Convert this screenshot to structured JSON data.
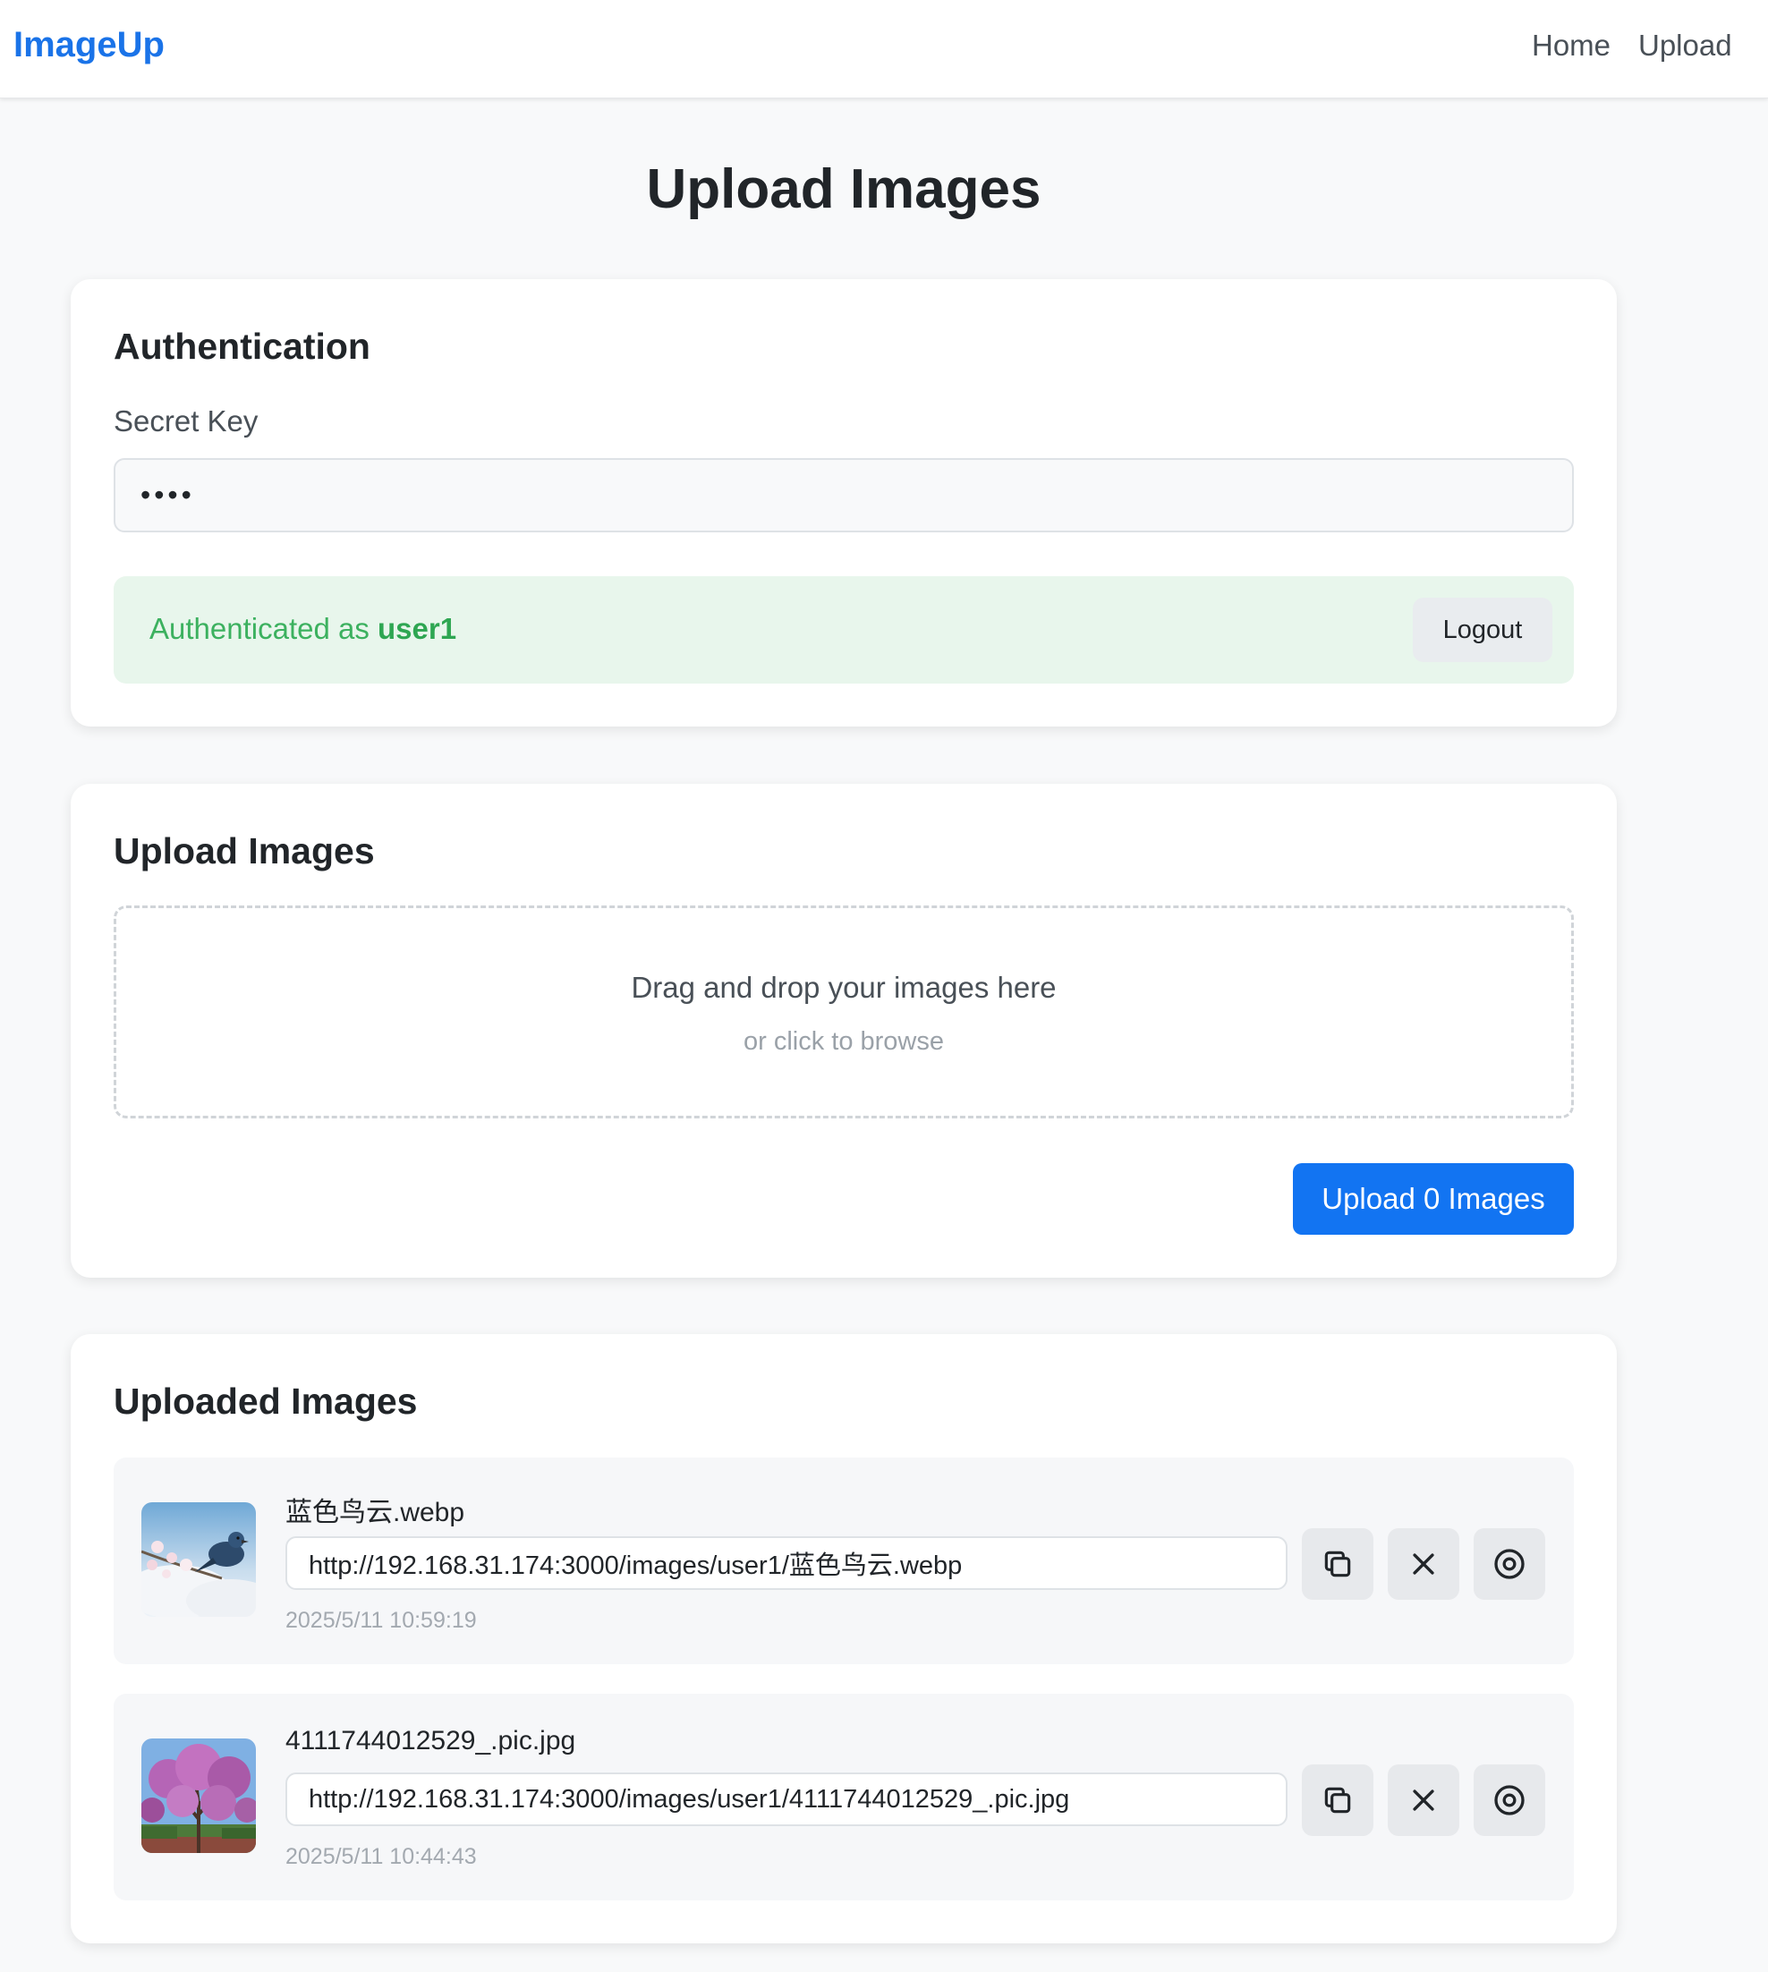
{
  "nav": {
    "brand": "ImageUp",
    "links": [
      "Home",
      "Upload"
    ]
  },
  "page": {
    "title": "Upload Images"
  },
  "auth": {
    "title": "Authentication",
    "secret_label": "Secret Key",
    "secret_value": "abcd",
    "status_prefix": "Authenticated as",
    "username": "user1",
    "logout_label": "Logout"
  },
  "upload": {
    "title": "Upload Images",
    "drop_main": "Drag and drop your images here",
    "drop_sub": "or click to browse",
    "button_label": "Upload 0 Images"
  },
  "uploaded": {
    "title": "Uploaded Images",
    "items": [
      {
        "name": "蓝色鸟云.webp",
        "url": "http://192.168.31.174:3000/images/user1/蓝色鸟云.webp",
        "time": "2025/5/11 10:59:19",
        "thumb_icon": "blue-bird-photo"
      },
      {
        "name": "4111744012529_.pic.jpg",
        "url": "http://192.168.31.174:3000/images/user1/4111744012529_.pic.jpg",
        "time": "2025/5/11 10:44:43",
        "thumb_icon": "blossom-tree-photo"
      }
    ],
    "action_icons": [
      "copy-icon",
      "close-icon",
      "eye-icon"
    ]
  },
  "colors": {
    "brand": "#1a73e8",
    "primary_button": "#1274f2",
    "success_bg": "#e8f6ec",
    "success_text": "#3cb15f"
  }
}
